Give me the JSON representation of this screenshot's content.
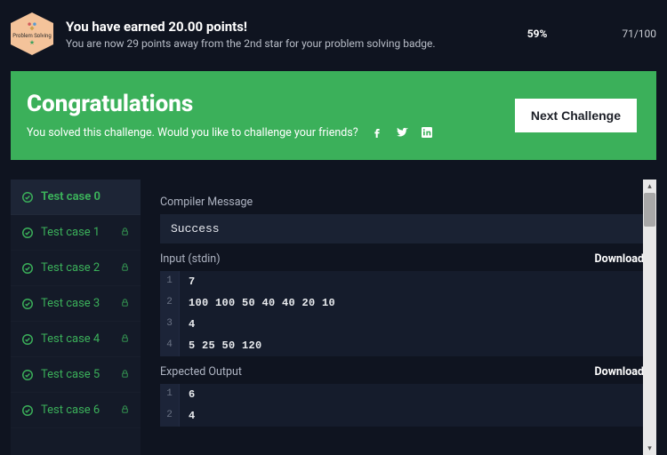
{
  "banner": {
    "badge_label": "Problem Solving",
    "title": "You have earned 20.00 points!",
    "subtitle": "You are now 29 points away from the 2nd star for your problem solving badge.",
    "percent": "59%",
    "score": "71/100"
  },
  "congrats": {
    "heading": "Congratulations",
    "subtext": "You solved this challenge. Would you like to challenge your friends?",
    "next_label": "Next Challenge"
  },
  "testcases": [
    {
      "label": "Test case 0",
      "locked": false,
      "active": true
    },
    {
      "label": "Test case 1",
      "locked": true,
      "active": false
    },
    {
      "label": "Test case 2",
      "locked": true,
      "active": false
    },
    {
      "label": "Test case 3",
      "locked": true,
      "active": false
    },
    {
      "label": "Test case 4",
      "locked": true,
      "active": false
    },
    {
      "label": "Test case 5",
      "locked": true,
      "active": false
    },
    {
      "label": "Test case 6",
      "locked": true,
      "active": false
    }
  ],
  "detail": {
    "compiler_label": "Compiler Message",
    "compiler_value": "Success",
    "input_label": "Input (stdin)",
    "input_lines": [
      "7",
      "100 100 50 40 40 20 10",
      "4",
      "5 25 50 120"
    ],
    "expected_label": "Expected Output",
    "expected_lines": [
      "6",
      "4"
    ],
    "download_label": "Download"
  }
}
